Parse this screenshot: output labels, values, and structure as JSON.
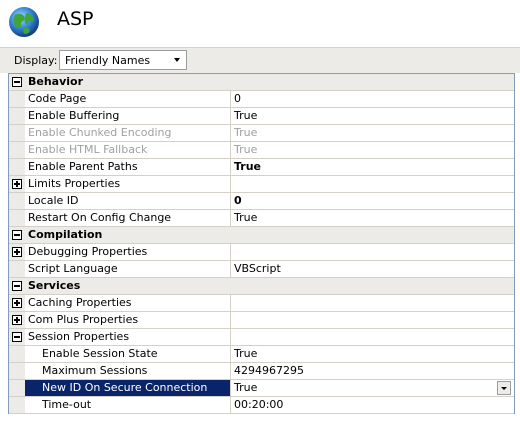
{
  "header": {
    "title": "ASP",
    "icon": "globe-icon"
  },
  "display": {
    "label": "Display:",
    "selected": "Friendly Names"
  },
  "rows": [
    {
      "type": "category",
      "label": "Behavior",
      "expander": "minus"
    },
    {
      "type": "prop",
      "label": "Code Page",
      "value": "0"
    },
    {
      "type": "prop",
      "label": "Enable Buffering",
      "value": "True"
    },
    {
      "type": "prop",
      "label": "Enable Chunked Encoding",
      "value": "True",
      "disabled": true
    },
    {
      "type": "prop",
      "label": "Enable HTML Fallback",
      "value": "True",
      "disabled": true
    },
    {
      "type": "prop",
      "label": "Enable Parent Paths",
      "value": "True",
      "bold": true
    },
    {
      "type": "group",
      "label": "Limits Properties",
      "expander": "plus"
    },
    {
      "type": "prop",
      "label": "Locale ID",
      "value": "0",
      "bold": true
    },
    {
      "type": "prop",
      "label": "Restart On Config Change",
      "value": "True"
    },
    {
      "type": "category",
      "label": "Compilation",
      "expander": "minus"
    },
    {
      "type": "group",
      "label": "Debugging Properties",
      "expander": "plus"
    },
    {
      "type": "prop",
      "label": "Script Language",
      "value": "VBScript"
    },
    {
      "type": "category",
      "label": "Services",
      "expander": "minus"
    },
    {
      "type": "group",
      "label": "Caching Properties",
      "expander": "plus"
    },
    {
      "type": "group",
      "label": "Com Plus Properties",
      "expander": "plus"
    },
    {
      "type": "group",
      "label": "Session Properties",
      "expander": "minus"
    },
    {
      "type": "subprop",
      "label": "Enable Session State",
      "value": "True"
    },
    {
      "type": "subprop",
      "label": "Maximum Sessions",
      "value": "4294967295"
    },
    {
      "type": "subprop",
      "label": "New ID On Secure Connection",
      "value": "True",
      "selected": true
    },
    {
      "type": "subprop",
      "label": "Time-out",
      "value": "00:20:00"
    }
  ]
}
